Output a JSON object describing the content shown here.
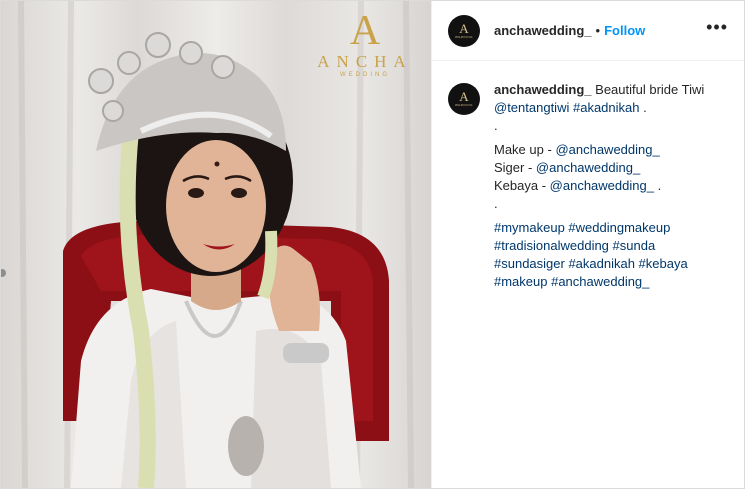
{
  "post": {
    "username": "anchawedding_",
    "separator": "•",
    "follow_label": "Follow",
    "more_label": "•••",
    "avatar": {
      "letter": "A",
      "word": "WEDDING"
    },
    "watermark": {
      "letter": "A",
      "word": "ANCHA",
      "sub": "WEDDING"
    },
    "caption": {
      "username": "anchawedding_",
      "line1_text": "Beautiful bride Tiwi",
      "line2_mention": "@tentangtiwi",
      "line2_hashtag": "#akadnikah",
      "line2_end": ".",
      "line3": ".",
      "makeup_label": "Make up -",
      "makeup_mention": "@anchawedding_",
      "siger_label": "Siger -",
      "siger_mention": "@anchawedding_",
      "kebaya_label": "Kebaya -",
      "kebaya_mention": "@anchawedding_",
      "kebaya_end": ".",
      "line7": ".",
      "hashtags_line1": "#mymakeup #weddingmakeup",
      "hashtags_line2": "#tradisionalwedding #sunda",
      "hashtags_line3": "#sundasiger #akadnikah #kebaya",
      "hashtags_line4": "#makeup #anchawedding_"
    }
  },
  "colors": {
    "link": "#00376b",
    "follow": "#0095f6",
    "watermark_gold": "#c9a24a",
    "chair_red": "#8b0f15"
  }
}
